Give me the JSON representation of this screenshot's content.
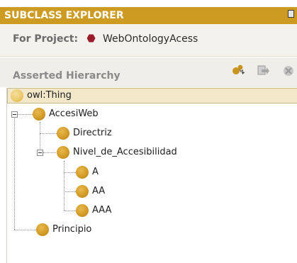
{
  "panel": {
    "title": "SUBCLASS EXPLORER",
    "project_label": "For Project:",
    "project_name": "WebOntologyAcess",
    "hierarchy_label": "Asserted Hierarchy"
  },
  "toolbar": {
    "icons": [
      "create-subclass-icon",
      "create-sibling-class-icon",
      "delete-class-icon"
    ]
  },
  "colors": {
    "title_bar": "#cd9a22",
    "class_ball": "#d39b26",
    "selection": "#f3e7c9",
    "project_icon": "#9a1b2c"
  },
  "tree": {
    "root": "owl:Thing",
    "accesiweb": "AccesiWeb",
    "directriz": "Directriz",
    "nivel": "Nivel_de_Accesibilidad",
    "a": "A",
    "aa": "AA",
    "aaa": "AAA",
    "principio": "Principio"
  }
}
